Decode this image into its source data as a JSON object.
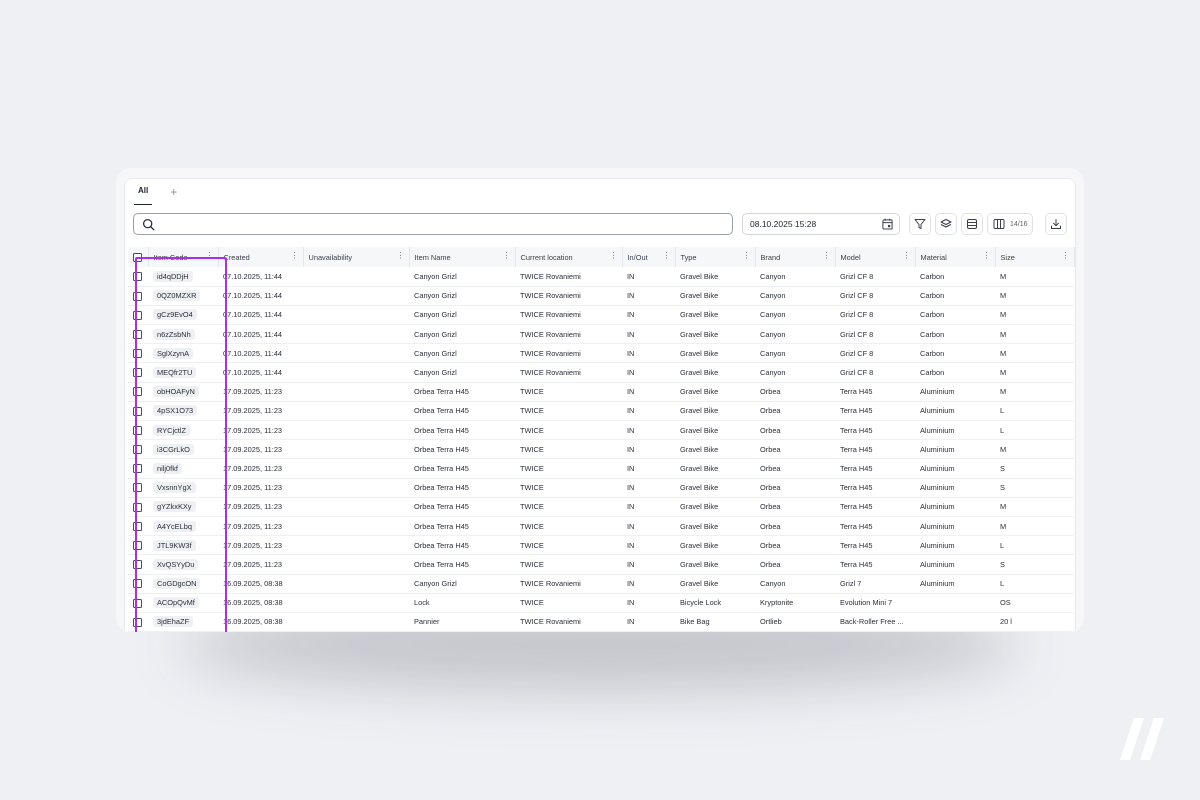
{
  "tabs": {
    "active": "All",
    "add": "+"
  },
  "search": {
    "placeholder": ""
  },
  "date_filter": {
    "value": "08.10.2025 15:28"
  },
  "toolbar": {
    "columns_count": "14/16"
  },
  "colors": {
    "highlight": "#b02ee0",
    "background": "#eff0f4"
  },
  "icons": [
    "search-icon",
    "calendar-icon",
    "filter-icon",
    "layers-icon",
    "density-icon",
    "columns-icon",
    "download-icon",
    "more-vertical-icon"
  ],
  "table": {
    "columns": [
      "Item Code",
      "Created",
      "Unavailability",
      "Item Name",
      "Current location",
      "In/Out",
      "Type",
      "Brand",
      "Model",
      "Material",
      "Size"
    ],
    "rows": [
      [
        "id4qDDjH",
        "07.10.2025, 11:44",
        "",
        "Canyon Grizl",
        "TWICE Rovaniemi",
        "IN",
        "Gravel Bike",
        "Canyon",
        "Grizl CF 8",
        "Carbon",
        "M"
      ],
      [
        "0QZ0MZXR",
        "07.10.2025, 11:44",
        "",
        "Canyon Grizl",
        "TWICE Rovaniemi",
        "IN",
        "Gravel Bike",
        "Canyon",
        "Grizl CF 8",
        "Carbon",
        "M"
      ],
      [
        "gCz9EvO4",
        "07.10.2025, 11:44",
        "",
        "Canyon Grizl",
        "TWICE Rovaniemi",
        "IN",
        "Gravel Bike",
        "Canyon",
        "Grizl CF 8",
        "Carbon",
        "M"
      ],
      [
        "n6zZsbNh",
        "07.10.2025, 11:44",
        "",
        "Canyon Grizl",
        "TWICE Rovaniemi",
        "IN",
        "Gravel Bike",
        "Canyon",
        "Grizl CF 8",
        "Carbon",
        "M"
      ],
      [
        "SglXzynA",
        "07.10.2025, 11:44",
        "",
        "Canyon Grizl",
        "TWICE Rovaniemi",
        "IN",
        "Gravel Bike",
        "Canyon",
        "Grizl CF 8",
        "Carbon",
        "M"
      ],
      [
        "MEQfr2TU",
        "07.10.2025, 11:44",
        "",
        "Canyon Grizl",
        "TWICE Rovaniemi",
        "IN",
        "Gravel Bike",
        "Canyon",
        "Grizl CF 8",
        "Carbon",
        "M"
      ],
      [
        "obHOAFyN",
        "17.09.2025, 11:23",
        "",
        "Orbea Terra H45",
        "TWICE",
        "IN",
        "Gravel Bike",
        "Orbea",
        "Terra H45",
        "Aluminium",
        "M"
      ],
      [
        "4pSX1O73",
        "17.09.2025, 11:23",
        "",
        "Orbea Terra H45",
        "TWICE",
        "IN",
        "Gravel Bike",
        "Orbea",
        "Terra H45",
        "Aluminium",
        "L"
      ],
      [
        "RYCjctlZ",
        "17.09.2025, 11:23",
        "",
        "Orbea Terra H45",
        "TWICE",
        "IN",
        "Gravel Bike",
        "Orbea",
        "Terra H45",
        "Aluminium",
        "L"
      ],
      [
        "i3CGrLkO",
        "17.09.2025, 11:23",
        "",
        "Orbea Terra H45",
        "TWICE",
        "IN",
        "Gravel Bike",
        "Orbea",
        "Terra H45",
        "Aluminium",
        "M"
      ],
      [
        "nilj0fkf",
        "17.09.2025, 11:23",
        "",
        "Orbea Terra H45",
        "TWICE",
        "IN",
        "Gravel Bike",
        "Orbea",
        "Terra H45",
        "Aluminium",
        "S"
      ],
      [
        "VxsnnYgX",
        "17.09.2025, 11:23",
        "",
        "Orbea Terra H45",
        "TWICE",
        "IN",
        "Gravel Bike",
        "Orbea",
        "Terra H45",
        "Aluminium",
        "S"
      ],
      [
        "gYZkxKXy",
        "17.09.2025, 11:23",
        "",
        "Orbea Terra H45",
        "TWICE",
        "IN",
        "Gravel Bike",
        "Orbea",
        "Terra H45",
        "Aluminium",
        "M"
      ],
      [
        "A4YcELbq",
        "17.09.2025, 11:23",
        "",
        "Orbea Terra H45",
        "TWICE",
        "IN",
        "Gravel Bike",
        "Orbea",
        "Terra H45",
        "Aluminium",
        "M"
      ],
      [
        "JTL9KW3f",
        "17.09.2025, 11:23",
        "",
        "Orbea Terra H45",
        "TWICE",
        "IN",
        "Gravel Bike",
        "Orbea",
        "Terra H45",
        "Aluminium",
        "L"
      ],
      [
        "XvQSYyDu",
        "17.09.2025, 11:23",
        "",
        "Orbea Terra H45",
        "TWICE",
        "IN",
        "Gravel Bike",
        "Orbea",
        "Terra H45",
        "Aluminium",
        "S"
      ],
      [
        "CoGDgcON",
        "16.09.2025, 08:38",
        "",
        "Canyon Grizl",
        "TWICE Rovaniemi",
        "IN",
        "Gravel Bike",
        "Canyon",
        "Grizl 7",
        "Aluminium",
        "L"
      ],
      [
        "ACOpQvMf",
        "16.09.2025, 08:38",
        "",
        "Lock",
        "TWICE",
        "IN",
        "Bicycle Lock",
        "Kryptonite",
        "Evolution Mini 7",
        "",
        "OS"
      ],
      [
        "3jdEhaZF",
        "16.09.2025, 08:38",
        "",
        "Pannier",
        "TWICE Rovaniemi",
        "IN",
        "Bike Bag",
        "Ortlieb",
        "Back-Roller Free ...",
        "",
        "20 l"
      ]
    ]
  }
}
